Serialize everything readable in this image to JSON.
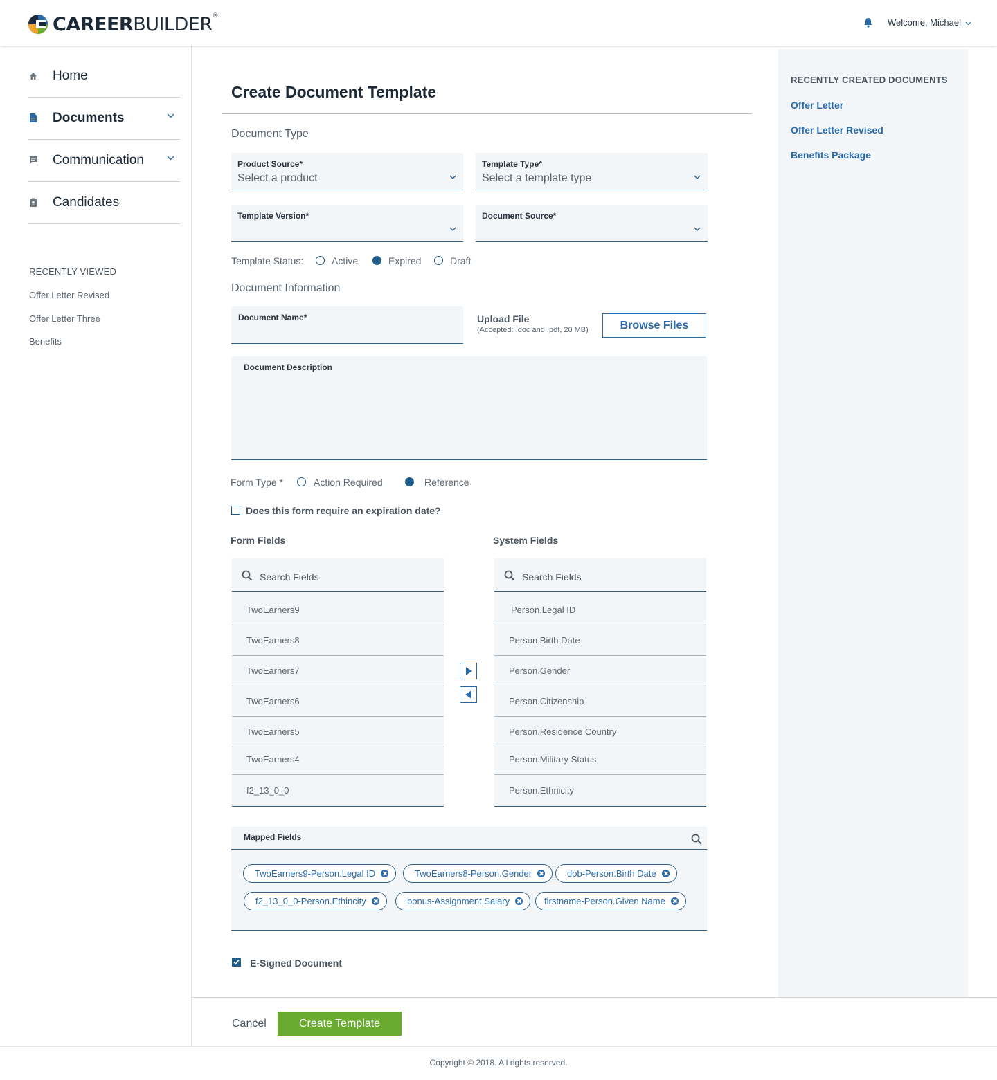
{
  "header": {
    "brand_bold": "CAREER",
    "brand_light": "BUILDER",
    "brand_mark": "®",
    "welcome": "Welcome, Michael",
    "accent": "#2a6aa8"
  },
  "sidebar": {
    "items": [
      {
        "label": "Home",
        "icon": "home-icon"
      },
      {
        "label": "Documents",
        "icon": "document-icon",
        "active": true
      },
      {
        "label": "Communication",
        "icon": "chat-icon"
      },
      {
        "label": "Candidates",
        "icon": "badge-icon"
      }
    ],
    "recent_title": "RECENTLY VIEWED",
    "recent": [
      "Offer Letter Revised",
      "Offer Letter Three",
      "Benefits"
    ]
  },
  "right_panel": {
    "title": "RECENTLY CREATED DOCUMENTS",
    "links": [
      "Offer Letter",
      "Offer Letter Revised",
      "Benefits Package"
    ]
  },
  "form": {
    "title": "Create Document Template",
    "doc_type_heading": "Document Type",
    "product_source": {
      "label": "Product Source*",
      "value": "Select a product"
    },
    "template_type": {
      "label": "Template Type*",
      "value": "Select a template type"
    },
    "template_version": {
      "label": "Template Version*",
      "value": ""
    },
    "document_source": {
      "label": "Document Source*",
      "value": ""
    },
    "status": {
      "label": "Template Status:",
      "options": [
        "Active",
        "Expired",
        "Draft"
      ],
      "selected": "Expired"
    },
    "doc_info_heading": "Document Information",
    "document_name": {
      "label": "Document Name*",
      "value": ""
    },
    "upload": {
      "label": "Upload File",
      "hint": "(Accepted: .doc and .pdf, 20 MB)",
      "button": "Browse Files"
    },
    "description": {
      "label": "Document Description",
      "value": ""
    },
    "form_type": {
      "label": "Form Type *",
      "options": [
        "Action Required",
        "Reference"
      ],
      "selected": "Reference"
    },
    "expiration": {
      "label": "Does this form require an expiration date?",
      "checked": false
    },
    "form_fields": {
      "heading": "Form Fields",
      "search": "Search Fields",
      "items": [
        "TwoEarners9",
        "TwoEarners8",
        "TwoEarners7",
        "TwoEarners6",
        "TwoEarners5",
        "TwoEarners4",
        "f2_13_0_0"
      ]
    },
    "system_fields": {
      "heading": "System Fields",
      "search": "Search Fields",
      "items": [
        "Person.Legal ID",
        "Person.Birth Date",
        "Person.Gender",
        "Person.Citizenship",
        "Person.Residence Country",
        "Person.Military Status",
        "Person.Ethnicity"
      ]
    },
    "mapped": {
      "label": "Mapped Fields",
      "chips": [
        "TwoEarners9-Person.Legal ID",
        "TwoEarners8-Person.Gender",
        "dob-Person.Birth Date",
        "f2_13_0_0-Person.Ethincity",
        "bonus-Assignment.Salary",
        "firstname-Person.Given Name"
      ]
    },
    "esigned": {
      "label": "E-Signed Document",
      "checked": true
    },
    "cancel": "Cancel",
    "submit": "Create Template",
    "submit_color": "#6aaa2f"
  },
  "footer": {
    "copyright": "Copyright © 2018. All rights reserved."
  }
}
